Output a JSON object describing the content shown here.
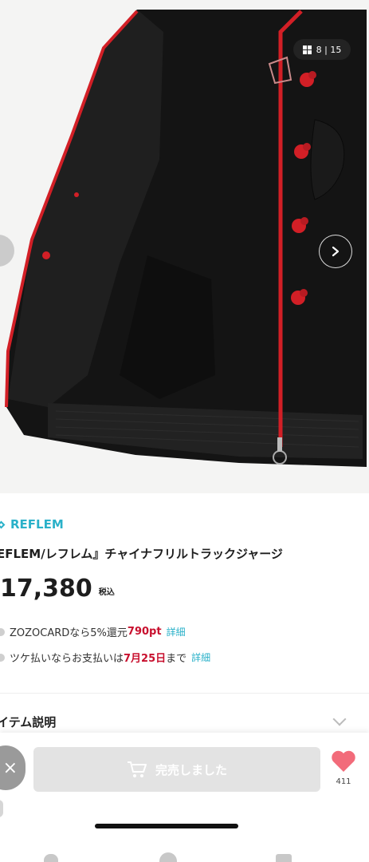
{
  "gallery": {
    "counter": "8 | 15",
    "icons": {
      "grid": "grid-icon",
      "prev": "chevron-left-icon",
      "next": "chevron-right-icon"
    }
  },
  "product": {
    "brand": "REFLEM",
    "title": "EFLEM/レフレム』チャイナフリルトラックジャージ",
    "price": "17,380",
    "tax_label": "税込"
  },
  "info": {
    "zozocard": {
      "prefix": "ZOZOCARDなら5%還元 ",
      "points": "790pt",
      "link": "詳細"
    },
    "tsuke": {
      "prefix": "ツケ払いならお支払いは",
      "date": "7月25日",
      "suffix": "まで",
      "link": "詳細"
    }
  },
  "section": {
    "description_label": "イテム説明"
  },
  "bottom_bar": {
    "close_symbol": "×",
    "soldout_label": "完売しました",
    "favorite_count": "411"
  },
  "colors": {
    "accent": "#2ab1c9",
    "price_red": "#c8102e",
    "heart": "#f26b7a",
    "button_gray": "#e3e3e3"
  }
}
